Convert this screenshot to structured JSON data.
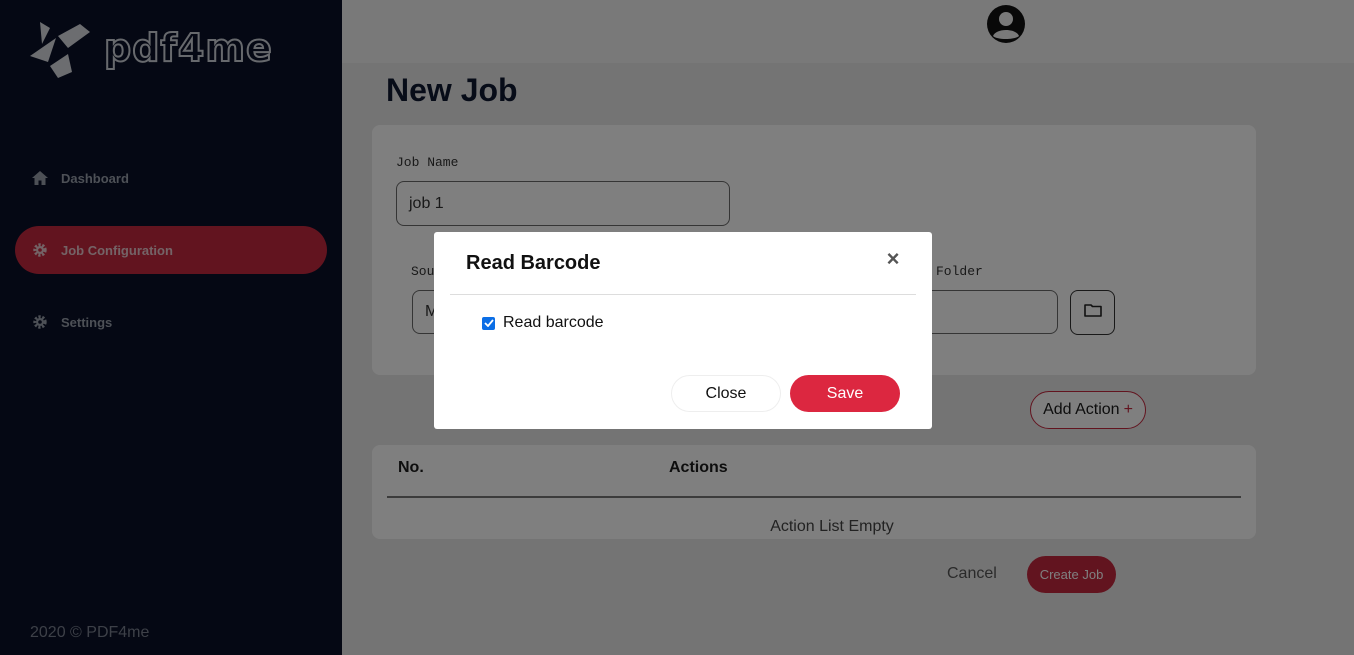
{
  "brand": {
    "name": "pdf4me",
    "accent": "#c5283f",
    "sidebar_bg": "#0a1128"
  },
  "sidebar": {
    "items": [
      {
        "label": "Dashboard",
        "icon": "home-icon",
        "active": false
      },
      {
        "label": "Job Configuration",
        "icon": "gear-icon",
        "active": true
      },
      {
        "label": "Settings",
        "icon": "gear-icon",
        "active": false
      }
    ],
    "footer": "2020 © PDF4me"
  },
  "header": {
    "avatar_icon": "user-circle-icon"
  },
  "page": {
    "title": "New Job",
    "job_name_label": "Job Name",
    "job_name_value": "job 1",
    "source_label_partial": "Sou",
    "source_value_partial": "M",
    "folder_label_partial": "Folder",
    "add_action_label": "Add Action",
    "add_action_plus": "+",
    "table": {
      "columns": [
        "No.",
        "Actions"
      ],
      "empty_text": "Action List Empty"
    },
    "cancel_label": "Cancel",
    "create_label": "Create Job"
  },
  "modal": {
    "title": "Read Barcode",
    "close_x": "×",
    "checkbox_label": "Read barcode",
    "checkbox_checked": true,
    "close_button": "Close",
    "save_button": "Save"
  }
}
